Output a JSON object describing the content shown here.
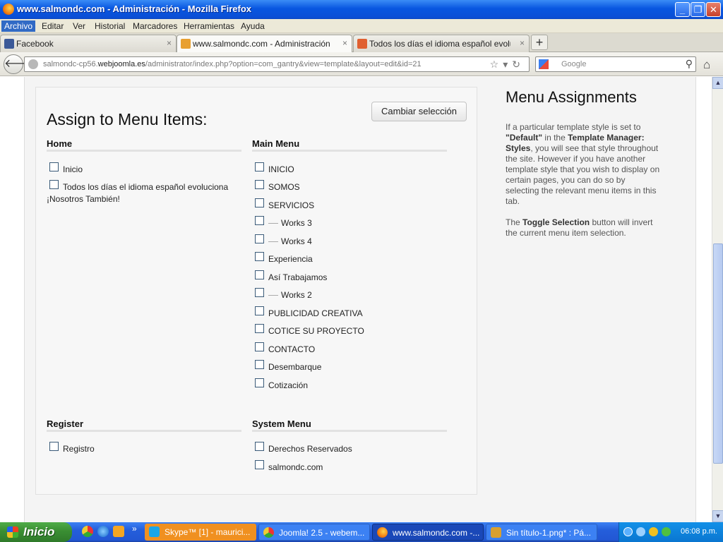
{
  "window": {
    "title": "www.salmondc.com - Administración - Mozilla Firefox",
    "buttons": {
      "minimize": "_",
      "maximize": "❐",
      "close": "✕"
    }
  },
  "menubar": [
    "Archivo",
    "Editar",
    "Ver",
    "Historial",
    "Marcadores",
    "Herramientas",
    "Ayuda"
  ],
  "tabs": [
    {
      "label": "Facebook",
      "icon": "facebook-icon",
      "color": "#3b5998"
    },
    {
      "label": "www.salmondc.com - Administración",
      "icon": "joomla-icon",
      "color": "#e8a030"
    },
    {
      "label": "Todos los días el idioma español evolucio...",
      "icon": "site-icon",
      "color": "#e06030"
    }
  ],
  "tab_close": "×",
  "new_tab": "+",
  "address": {
    "prefix": "salmondc-cp56.",
    "domain": "webjoomla.es",
    "path": "/administrator/index.php?option=com_gantry&view=template&layout=edit&id=21"
  },
  "search": {
    "placeholder": "Google"
  },
  "panel": {
    "title": "Assign to Menu Items:",
    "toggle_button": "Cambiar selección",
    "groups": {
      "home": {
        "heading": "Home",
        "items": [
          "Inicio",
          "Todos los días el idioma español evoluciona ¡Nosotros También!"
        ]
      },
      "main_menu": {
        "heading": "Main Menu",
        "items": [
          "INICIO",
          "SOMOS",
          "SERVICIOS",
          "Works 3",
          "Works 4",
          "Experiencia",
          "Así Trabajamos",
          "Works 2",
          "PUBLICIDAD CREATIVA",
          "COTICE SU PROYECTO",
          "CONTACTO",
          "Desembarque",
          "Cotización"
        ]
      },
      "register": {
        "heading": "Register",
        "items": [
          "Registro"
        ]
      },
      "system_menu": {
        "heading": "System Menu",
        "items": [
          "Derechos Reservados",
          "salmondc.com"
        ]
      }
    }
  },
  "help": {
    "title": "Menu Assignments",
    "p1_a": "If a particular template style is set to ",
    "p1_b": "\"Default\"",
    "p1_c": " in the ",
    "p1_d": "Template Manager: Styles",
    "p1_e": ", you will see that style throughout the site. However if you have another template style that you wish to display on certain pages, you can do so by selecting the relevant menu items in this tab.",
    "p2_a": "The ",
    "p2_b": "Toggle Selection",
    "p2_c": " button will invert the current menu item selection."
  },
  "taskbar": {
    "start": "Inicio",
    "chevron": "»",
    "buttons": [
      {
        "label": "Skype™ [1] - maurici...",
        "color": "#f09020"
      },
      {
        "label": "Joomla! 2.5 - webem...",
        "color": "#3c81f3"
      },
      {
        "label": "www.salmondc.com -...",
        "color": "#1a48b8"
      },
      {
        "label": "Sin título-1.png* : Pá...",
        "color": "#3c81f3"
      }
    ],
    "clock": "06:08 p.m."
  }
}
